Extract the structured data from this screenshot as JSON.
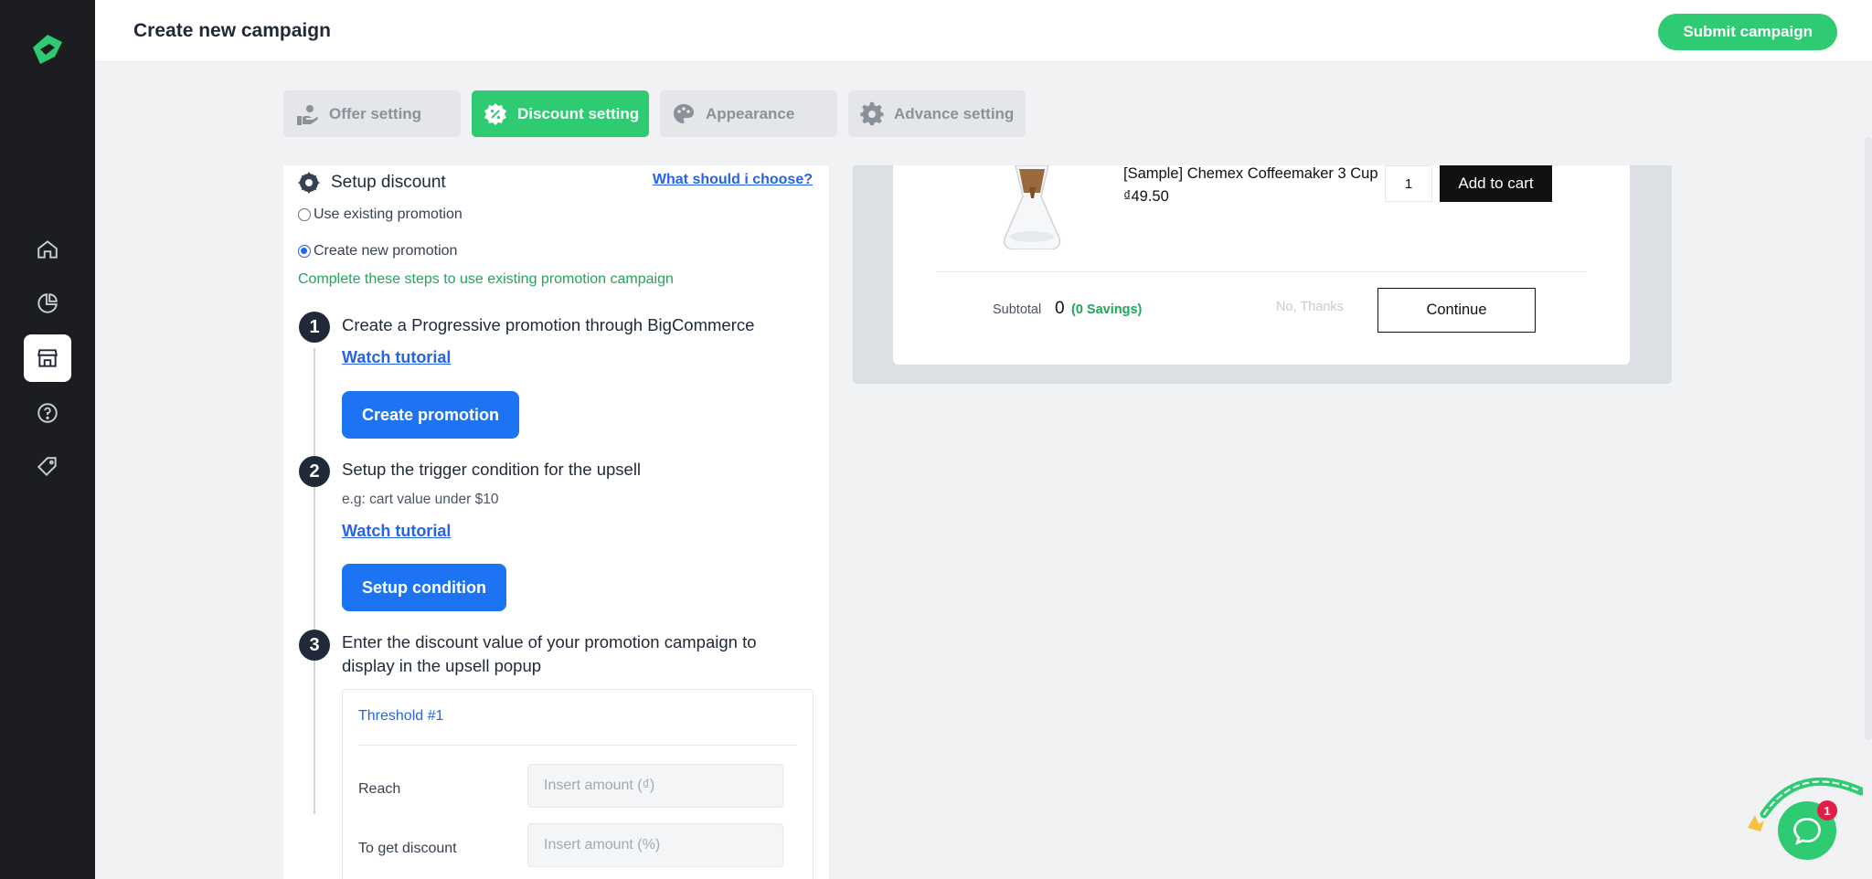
{
  "header": {
    "title": "Create new campaign",
    "submit_label": "Submit campaign"
  },
  "sidebar": {
    "items": [
      {
        "icon": "home-icon"
      },
      {
        "icon": "chart-icon"
      },
      {
        "icon": "store-icon",
        "active": true
      },
      {
        "icon": "help-icon"
      },
      {
        "icon": "tag-icon"
      }
    ]
  },
  "tabs": [
    {
      "label": "Offer setting",
      "icon": "offer-hand-icon"
    },
    {
      "label": "Discount setting",
      "icon": "discount-badge-icon",
      "active": true
    },
    {
      "label": "Appearance",
      "icon": "palette-icon"
    },
    {
      "label": "Advance setting",
      "icon": "gear-icon"
    }
  ],
  "setup": {
    "title": "Setup discount",
    "help_link": "What should i choose?",
    "option_existing": "Use existing promotion",
    "option_new": "Create new promotion",
    "hint": "Complete these steps to use existing promotion campaign"
  },
  "steps": [
    {
      "number": "1",
      "title": "Create a Progressive promotion through BigCommerce",
      "link": "Watch tutorial",
      "button": "Create promotion"
    },
    {
      "number": "2",
      "title": "Setup the trigger condition for the upsell",
      "subtitle": "e.g: cart value under $10",
      "link": "Watch tutorial",
      "button": "Setup condition"
    },
    {
      "number": "3",
      "title_line1": "Enter the discount value of your promotion campaign to",
      "title_line2": "display in the upsell popup"
    }
  ],
  "threshold": {
    "title": "Threshold #1",
    "reach_label": "Reach",
    "reach_placeholder": "Insert amount (₫)",
    "discount_label": "To get discount",
    "discount_placeholder": "Insert amount (%)"
  },
  "preview": {
    "product_name": "[Sample] Chemex Coffeemaker 3 Cup",
    "price": "₫49.50",
    "quantity": "1",
    "add_to_cart": "Add to cart",
    "subtotal_label": "Subtotal",
    "subtotal_value": "0",
    "savings": "(0 Savings)",
    "no_thanks": "No, Thanks",
    "continue": "Continue"
  },
  "chat": {
    "badge": "1",
    "colors": {
      "accent": "#2ecb72",
      "badge": "#e11d48"
    }
  },
  "colors": {
    "brand_green": "#2ecb72",
    "primary_blue": "#1d74f2",
    "sidebar_bg": "#1b1d20"
  }
}
